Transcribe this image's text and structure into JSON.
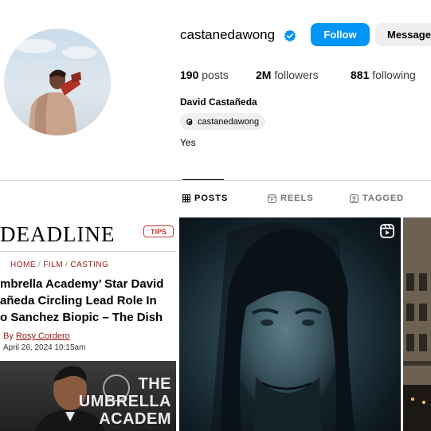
{
  "profile": {
    "username": "castanedawong",
    "verified": true,
    "follow_label": "Follow",
    "message_label": "Message",
    "stats": {
      "posts_count": "190",
      "posts_label": "posts",
      "followers_count": "2M",
      "followers_label": "followers",
      "following_count": "881",
      "following_label": "following"
    },
    "full_name": "David Castañeda",
    "threads_handle": "castanedawong",
    "bio": "Yes"
  },
  "tabs": [
    {
      "label": "POSTS",
      "icon": "grid-icon",
      "active": true
    },
    {
      "label": "REELS",
      "icon": "reels-icon",
      "active": false
    },
    {
      "label": "TAGGED",
      "icon": "tagged-icon",
      "active": false
    }
  ],
  "posts": {
    "article": {
      "logo": "DEADLINE",
      "tips": "TIPS",
      "crumbs": [
        "HOME",
        "FILM",
        "CASTING"
      ],
      "headline": "mbrella Academy’ Star David\nañeda Circling Lead Role In\no Sanchez Biopic – The Dish",
      "byline_prefix": "By",
      "author": "Rosy Cordero",
      "date": "April 26, 2024 10:15am",
      "photo_text": "THE\nUMBRELLA\nACADEM"
    },
    "reel_icon": "reel-badge-icon"
  },
  "colors": {
    "follow_button": "#0095f6",
    "verified_badge": "#0095f6",
    "secondary_button": "#efefef",
    "deadline_accent": "#9b1a1a"
  }
}
